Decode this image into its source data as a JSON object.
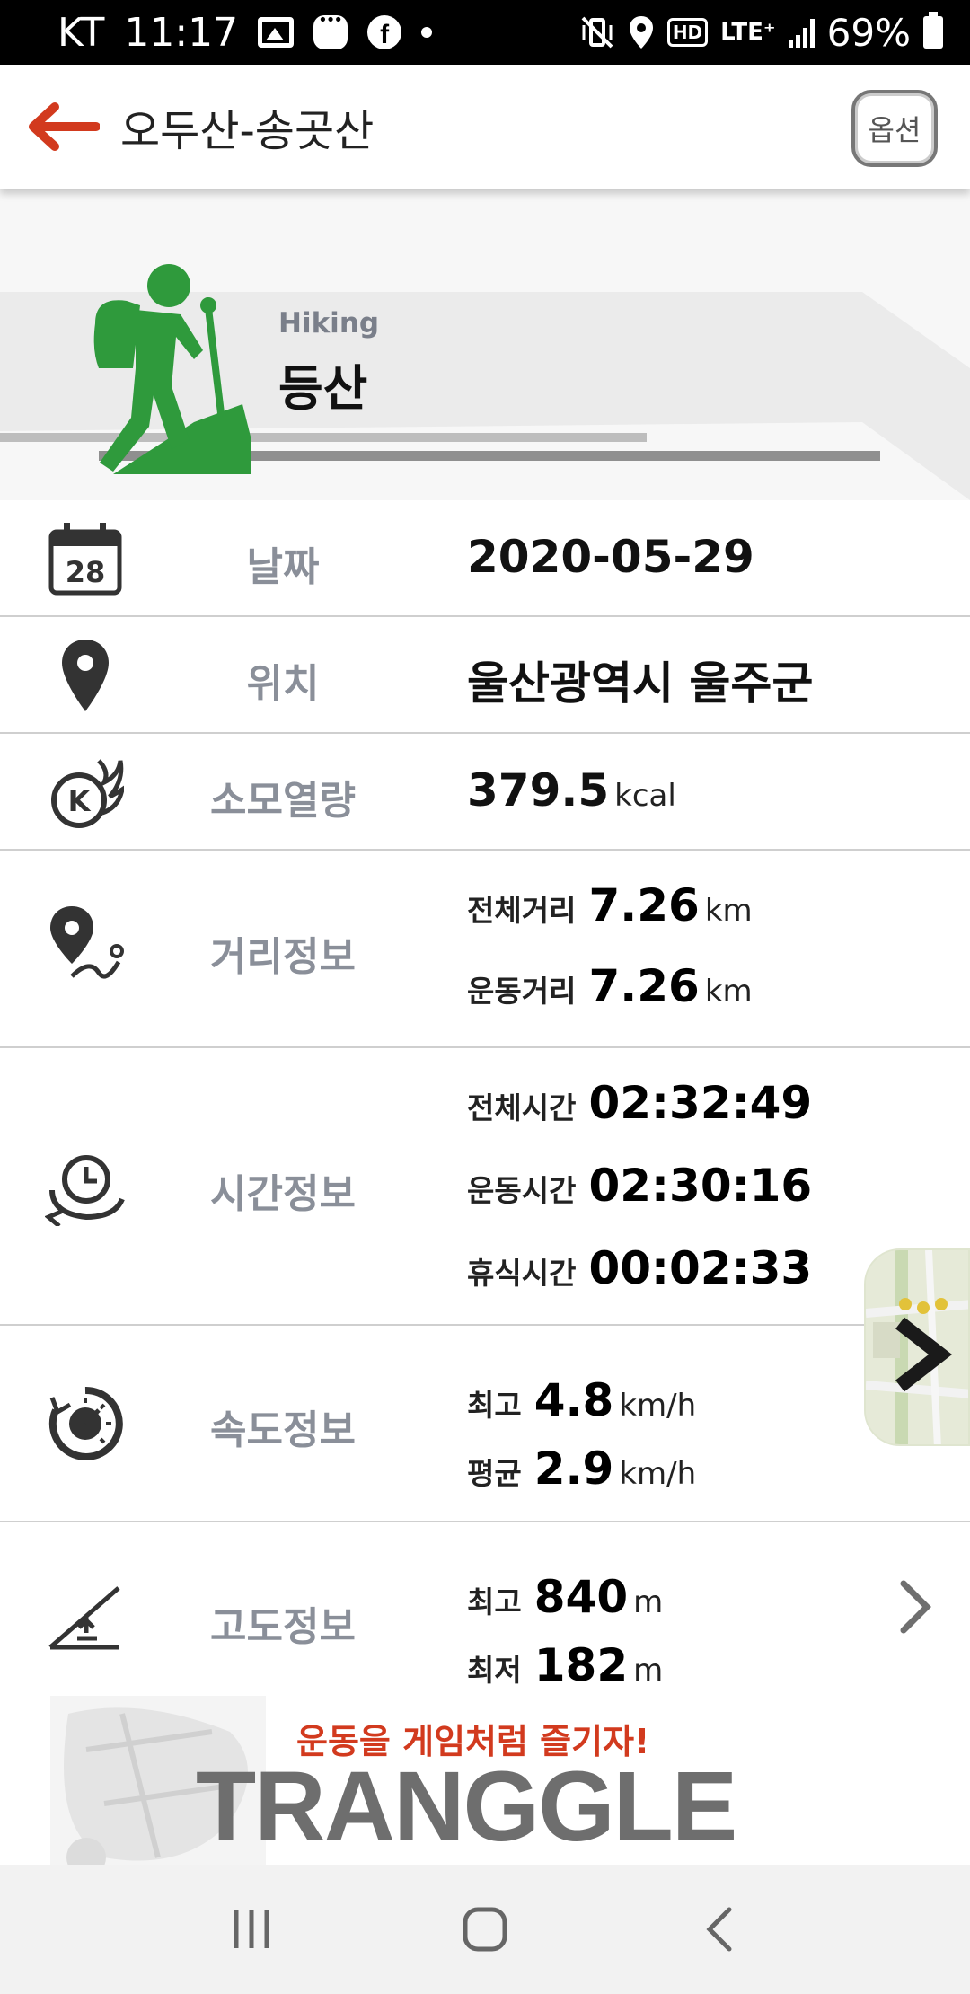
{
  "status_bar": {
    "carrier": "KT",
    "time": "11:17",
    "network_badge": "HD",
    "network": "LTE⁺",
    "battery": "69%"
  },
  "header": {
    "title": "오두산-송곳산",
    "options_label": "옵션"
  },
  "hero": {
    "subtitle": "Hiking",
    "title": "등산",
    "accent_color": "#2f9a3c"
  },
  "rows": {
    "date": {
      "label": "날짜",
      "value": "2020-05-29",
      "calendar_day": "28"
    },
    "location": {
      "label": "위치",
      "value": "울산광역시 울주군"
    },
    "calories": {
      "label": "소모열량",
      "value": "379.5",
      "unit": "kcal"
    },
    "distance": {
      "label": "거리정보",
      "total_label": "전체거리",
      "total_value": "7.26",
      "total_unit": "km",
      "moving_label": "운동거리",
      "moving_value": "7.26",
      "moving_unit": "km"
    },
    "time": {
      "label": "시간정보",
      "total_label": "전체시간",
      "total_value": "02:32:49",
      "moving_label": "운동시간",
      "moving_value": "02:30:16",
      "rest_label": "휴식시간",
      "rest_value": "00:02:33"
    },
    "speed": {
      "label": "속도정보",
      "max_label": "최고",
      "max_value": "4.8",
      "max_unit": "km/h",
      "avg_label": "평균",
      "avg_value": "2.9",
      "avg_unit": "km/h"
    },
    "altitude": {
      "label": "고도정보",
      "max_label": "최고",
      "max_value": "840",
      "max_unit": "m",
      "min_label": "최저",
      "min_value": "182",
      "min_unit": "m"
    }
  },
  "banner": {
    "tagline": "운동을 게임처럼 즐기자!",
    "brand": "TRANGGLE",
    "tagline_color": "#d23a1e"
  },
  "icons": [
    "back-arrow-icon",
    "calendar-icon",
    "location-pin-icon",
    "calorie-flame-icon",
    "route-pin-icon",
    "clock-icon",
    "speedometer-icon",
    "altitude-icon",
    "chevron-right-icon",
    "map-thumbnail",
    "hiker-icon"
  ]
}
